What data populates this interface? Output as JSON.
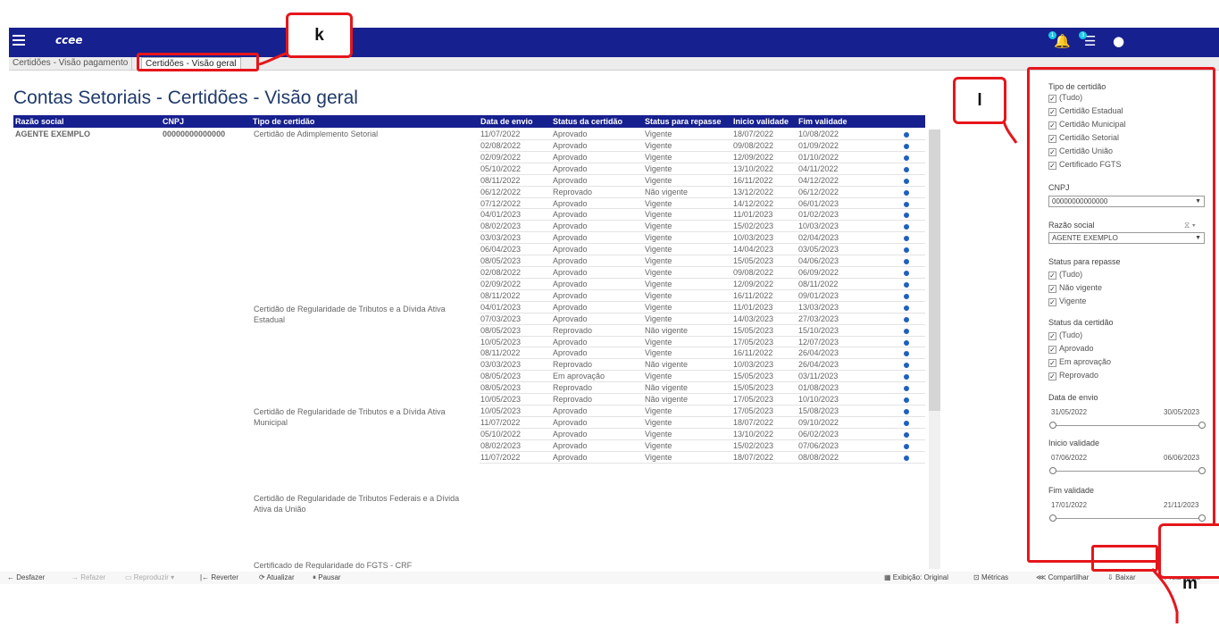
{
  "app": {
    "logo": "ccee"
  },
  "tabs": [
    "Certidões - Visão pagamento",
    "Certidões - Visão geral"
  ],
  "page_title": "Contas Setoriais - Certidões - Visão geral",
  "table": {
    "headers": [
      "Razão social",
      "CNPJ",
      "Tipo de certidão",
      "Data de envio",
      "Status da certidão",
      "Status para repasse",
      "Inicio validade",
      "Fim validade"
    ],
    "razao_social": "AGENTE EXEMPLO",
    "cnpj": "00000000000000",
    "tipos": [
      "Certidão de Adimplemento Setorial",
      "Certidão de Regularidade de Tributos e a Dívida Ativa",
      "Estadual",
      "Certidão de Regularidade de Tributos e a Dívida Ativa",
      "Municipal",
      "Certidão de Regularidade de Tributos Federais e a Dívida",
      "Ativa da União",
      "Certificado de Regularidade do FGTS - CRF"
    ],
    "rows": [
      [
        "11/07/2022",
        "Aprovado",
        "Vigente",
        "18/07/2022",
        "10/08/2022"
      ],
      [
        "02/08/2022",
        "Aprovado",
        "Vigente",
        "09/08/2022",
        "01/09/2022"
      ],
      [
        "02/09/2022",
        "Aprovado",
        "Vigente",
        "12/09/2022",
        "01/10/2022"
      ],
      [
        "05/10/2022",
        "Aprovado",
        "Vigente",
        "13/10/2022",
        "04/11/2022"
      ],
      [
        "08/11/2022",
        "Aprovado",
        "Vigente",
        "16/11/2022",
        "04/12/2022"
      ],
      [
        "06/12/2022",
        "Reprovado",
        "Não vigente",
        "13/12/2022",
        "06/12/2022"
      ],
      [
        "07/12/2022",
        "Aprovado",
        "Vigente",
        "14/12/2022",
        "06/01/2023"
      ],
      [
        "04/01/2023",
        "Aprovado",
        "Vigente",
        "11/01/2023",
        "01/02/2023"
      ],
      [
        "08/02/2023",
        "Aprovado",
        "Vigente",
        "15/02/2023",
        "10/03/2023"
      ],
      [
        "03/03/2023",
        "Aprovado",
        "Vigente",
        "10/03/2023",
        "02/04/2023"
      ],
      [
        "06/04/2023",
        "Aprovado",
        "Vigente",
        "14/04/2023",
        "03/05/2023"
      ],
      [
        "08/05/2023",
        "Aprovado",
        "Vigente",
        "15/05/2023",
        "04/06/2023"
      ],
      [
        "02/08/2022",
        "Aprovado",
        "Vigente",
        "09/08/2022",
        "06/09/2022"
      ],
      [
        "02/09/2022",
        "Aprovado",
        "Vigente",
        "12/09/2022",
        "08/11/2022"
      ],
      [
        "08/11/2022",
        "Aprovado",
        "Vigente",
        "16/11/2022",
        "09/01/2023"
      ],
      [
        "04/01/2023",
        "Aprovado",
        "Vigente",
        "11/01/2023",
        "13/03/2023"
      ],
      [
        "07/03/2023",
        "Aprovado",
        "Vigente",
        "14/03/2023",
        "27/03/2023"
      ],
      [
        "08/05/2023",
        "Reprovado",
        "Não vigente",
        "15/05/2023",
        "15/10/2023"
      ],
      [
        "10/05/2023",
        "Aprovado",
        "Vigente",
        "17/05/2023",
        "12/07/2023"
      ],
      [
        "08/11/2022",
        "Aprovado",
        "Vigente",
        "16/11/2022",
        "26/04/2023"
      ],
      [
        "03/03/2023",
        "Reprovado",
        "Não vigente",
        "10/03/2023",
        "26/04/2023"
      ],
      [
        "08/05/2023",
        "Em aprovação",
        "Vigente",
        "15/05/2023",
        "03/11/2023"
      ],
      [
        "08/05/2023",
        "Reprovado",
        "Não vigente",
        "15/05/2023",
        "01/08/2023"
      ],
      [
        "10/05/2023",
        "Reprovado",
        "Não vigente",
        "17/05/2023",
        "10/10/2023"
      ],
      [
        "10/05/2023",
        "Aprovado",
        "Vigente",
        "17/05/2023",
        "15/08/2023"
      ],
      [
        "11/07/2022",
        "Aprovado",
        "Vigente",
        "18/07/2022",
        "09/10/2022"
      ],
      [
        "05/10/2022",
        "Aprovado",
        "Vigente",
        "13/10/2022",
        "06/02/2023"
      ],
      [
        "08/02/2023",
        "Aprovado",
        "Vigente",
        "15/02/2023",
        "07/06/2023"
      ],
      [
        "11/07/2022",
        "Aprovado",
        "Vigente",
        "18/07/2022",
        "08/08/2022"
      ]
    ]
  },
  "filters": {
    "tipo_label": "Tipo de certidão",
    "tipo_options": [
      "(Tudo)",
      "Certidão Estadual",
      "Certidão Municipal",
      "Certidão Setorial",
      "Certidão União",
      "Certificado FGTS"
    ],
    "cnpj_label": "CNPJ",
    "cnpj_value": "00000000000000",
    "razao_label": "Razão social",
    "razao_value": "AGENTE EXEMPLO",
    "repasse_label": "Status para repasse",
    "repasse_options": [
      "(Tudo)",
      "Não vigente",
      "Vigente"
    ],
    "status_label": "Status da certidão",
    "status_options": [
      "(Tudo)",
      "Aprovado",
      "Em aprovação",
      "Reprovado"
    ],
    "data_envio_label": "Data de envio",
    "data_envio_min": "31/05/2022",
    "data_envio_max": "30/05/2023",
    "inicio_label": "Inicio validade",
    "inicio_min": "07/06/2022",
    "inicio_max": "06/06/2023",
    "fim_label": "Fim validade",
    "fim_min": "17/01/2022",
    "fim_max": "21/11/2023",
    "check_glyph": "✓"
  },
  "toolbar": {
    "desfazer": "Desfazer",
    "refazer": "Refazer",
    "reproduzir": "Reproduzir",
    "reverter": "Reverter",
    "atualizar": "Atualizar",
    "pausar": "Pausar",
    "exibicao": "Exibição: Original",
    "metricas": "Métricas",
    "compartilhar": "Compartilhar",
    "baixar": "Baixar",
    "tela_cheia": "Tela cheia"
  },
  "callouts": {
    "k": "k",
    "l": "l",
    "m": "m"
  },
  "colors": {
    "header_blue": "#17208f",
    "highlight_red": "#e5161b",
    "dot_blue": "#1f5fbf"
  }
}
